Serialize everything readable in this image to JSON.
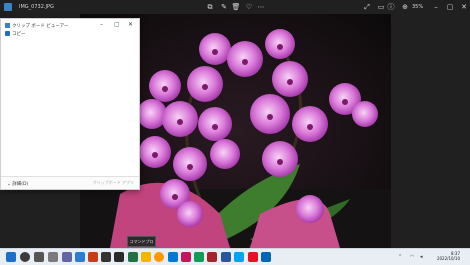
{
  "window": {
    "filename": "IMG_0732.JPG",
    "zoom": "35%"
  },
  "clipboard": {
    "title": "クリップ ボード ビューアー",
    "item_label": "コピー",
    "details_label": "詳細(D)",
    "action_label": "クリップボード アプリ"
  },
  "tooltip": "コマンドプロンプト",
  "taskbar": {
    "time": "8:37",
    "date": "2022/10/10"
  },
  "colors": {
    "accent": "#3b82c4",
    "flower": "#c24fc8",
    "background": "#1f1f1f"
  }
}
